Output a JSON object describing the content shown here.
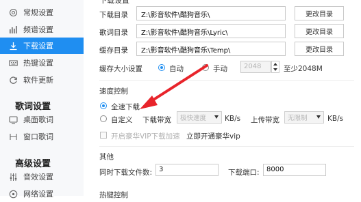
{
  "sidebar": {
    "items": [
      {
        "label": "常规设置",
        "icon": "gear-icon"
      },
      {
        "label": "频谱设置",
        "icon": "spectrum-icon"
      },
      {
        "label": "下载设置",
        "icon": "download-icon"
      },
      {
        "label": "热键设置",
        "icon": "keyboard-icon"
      },
      {
        "label": "软件更新",
        "icon": "update-icon"
      }
    ],
    "group_lyrics": "歌词设置",
    "lyrics_items": [
      {
        "label": "桌面歌词",
        "icon": "desktop-lyrics-icon"
      },
      {
        "label": "窗口歌词",
        "icon": "window-lyrics-icon"
      }
    ],
    "group_advanced": "高级设置",
    "advanced_items": [
      {
        "label": "音效设置",
        "icon": "equalizer-icon"
      },
      {
        "label": "网络设置",
        "icon": "network-icon"
      }
    ]
  },
  "download": {
    "section_title": "下载设置",
    "rows": [
      {
        "label": "下载目录",
        "path": "Z:\\影音软件\\酷狗音乐\\",
        "button": "更改目录"
      },
      {
        "label": "歌词目录",
        "path": "Z:\\影音软件\\酷狗音乐\\Lyric\\",
        "button": "更改目录"
      },
      {
        "label": "缓存目录",
        "path": "Z:\\影音软件\\酷狗音乐\\Temp\\",
        "button": "更改目录"
      }
    ],
    "cache_label": "缓存大小设置",
    "cache_auto": "自动",
    "cache_manual": "手动",
    "cache_value": "2048",
    "cache_hint": "至少2048M"
  },
  "speed": {
    "title": "速度控制",
    "full_speed": "全速下载",
    "custom": "自定义",
    "down_label": "下载带宽",
    "down_value": "极快速度",
    "down_unit": "KB/s",
    "up_label": "上传带宽",
    "up_value": "无限制",
    "up_unit": "KB/s",
    "vip_checkbox": "开启豪华VIP下载加速",
    "vip_link": "立即开通豪华vip"
  },
  "other": {
    "title": "其他",
    "concurrent_label": "同时下载文件数:",
    "concurrent_value": "3",
    "port_label": "下载端口:",
    "port_value": "8000"
  },
  "hotkey_title": "热键控制",
  "colors": {
    "accent": "#1f8ef1",
    "arrow": "#e8242b"
  }
}
